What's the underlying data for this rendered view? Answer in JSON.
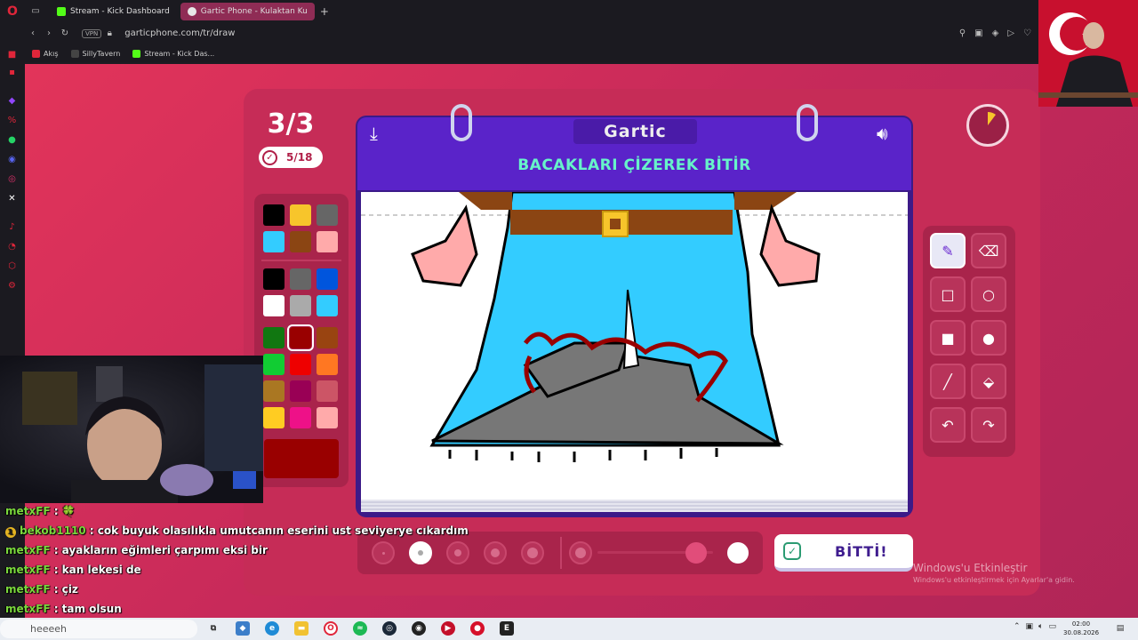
{
  "browser": {
    "tabs": [
      {
        "label": "Stream - Kick Dashboard",
        "active": false
      },
      {
        "label": "Gartic Phone - Kulaktan Ku",
        "active": true
      }
    ],
    "url": "garticphone.com/tr/draw",
    "vpn_label": "VPN",
    "bookmarks": [
      "Akış",
      "SillyTavern",
      "Stream - Kick Das..."
    ]
  },
  "game": {
    "round": "3/3",
    "players_done": "5/18",
    "logo": "Gartic",
    "instruction": "BACAKLARI ÇİZEREK BİTİR",
    "done_label": "BİTTİ!",
    "palette": [
      "#000000",
      "#f7c52b",
      "#666666",
      "#33ccff",
      "#8b4513",
      "#ffaaaa",
      "#000000",
      "#666666",
      "#0055dd",
      "#ffffff",
      "#aaaaaa",
      "#33ccff",
      "#117711",
      "#990000",
      "#994411",
      "#11cc33",
      "#ee0000",
      "#ff7722",
      "#aa7722",
      "#990055",
      "#cc5566",
      "#ffcc22",
      "#ee1188",
      "#ffaaaa"
    ],
    "selected_color": "#990000",
    "tools": [
      "pencil-icon",
      "eraser-icon",
      "rectangle-outline-icon",
      "ellipse-outline-icon",
      "rectangle-filled-icon",
      "ellipse-filled-icon",
      "line-icon",
      "fill-bucket-icon",
      "undo-icon",
      "redo-icon"
    ],
    "active_tool": "pencil-icon",
    "brush_sizes": 5,
    "active_brush_size": 2,
    "opacity_level": 0.85
  },
  "windows_watermark": {
    "title": "Windows'u Etkinleştir",
    "subtitle": "Windows'u etkinleştirmek için Ayarlar'a gidin."
  },
  "chat": [
    {
      "user": "metxFF",
      "message": ": 🍀"
    },
    {
      "user": "bekob1110",
      "message": ": cok buyuk olasılıkla umutcanın eserini ust seviyerye cıkardım",
      "badge": "1"
    },
    {
      "user": "metxFF",
      "message": ": ayakların eğimleri çarpımı eksi bir"
    },
    {
      "user": "metxFF",
      "message": ": kan lekesi de"
    },
    {
      "user": "metxFF",
      "message": ": çiz"
    },
    {
      "user": "metxFF",
      "message": ": tam olsun"
    }
  ],
  "taskbar": {
    "search_text": "heeeeh",
    "time": "02:00",
    "date": "30.08.2026"
  }
}
